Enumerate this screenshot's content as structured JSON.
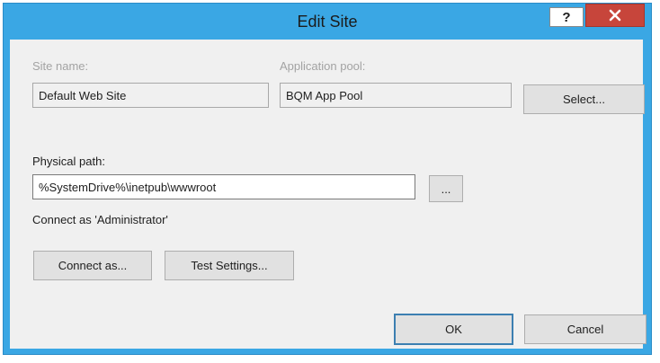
{
  "window": {
    "title": "Edit Site",
    "help_label": "?"
  },
  "site_name": {
    "label": "Site name:",
    "value": "Default Web Site"
  },
  "app_pool": {
    "label": "Application pool:",
    "value": "BQM App Pool",
    "select_label": "Select..."
  },
  "physical_path": {
    "label": "Physical path:",
    "value": "%SystemDrive%\\inetpub\\wwwroot",
    "browse_label": "..."
  },
  "connect": {
    "status": "Connect as 'Administrator'",
    "connect_as_label": "Connect as...",
    "test_settings_label": "Test Settings..."
  },
  "footer": {
    "ok_label": "OK",
    "cancel_label": "Cancel"
  },
  "colors": {
    "title_bar": "#3aa7e4",
    "close_button": "#c7453b",
    "client_background": "#f0f0f0"
  }
}
